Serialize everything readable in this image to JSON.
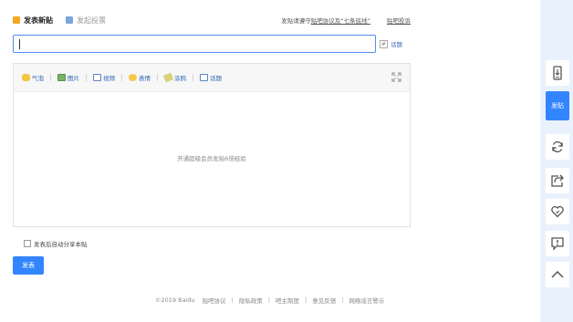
{
  "header": {
    "tab_new_post": "发表新贴",
    "tab_vote": "发起投票",
    "rules_prefix": "发贴请遵守",
    "rules_link": "贴吧协议及“七条底线”",
    "complaint_link": "贴吧投诉"
  },
  "title_input": {
    "value": "",
    "placeholder": ""
  },
  "topic_link": "话题",
  "toolbar": {
    "items": [
      {
        "label": "气泡",
        "icon": "bubble-icon"
      },
      {
        "label": "图片",
        "icon": "picture-icon"
      },
      {
        "label": "视频",
        "icon": "video-icon"
      },
      {
        "label": "表情",
        "icon": "emoji-icon"
      },
      {
        "label": "涂鸦",
        "icon": "doodle-icon"
      },
      {
        "label": "话题",
        "icon": "topic-icon"
      }
    ],
    "expand_icon": "expand-icon"
  },
  "editor": {
    "vip_hint": "开通超级会员发贴6倍经验"
  },
  "share_checkbox": {
    "label": "发表后自动分享本贴",
    "checked": false
  },
  "submit_label": "发表",
  "footer": {
    "items": [
      "©2019 Baidu",
      "贴吧协议",
      "隐私政策",
      "吧主制度",
      "意见反馈",
      "网络谣言警示"
    ],
    "separator": "|"
  },
  "rail": {
    "post_label": "发贴",
    "icons": [
      "mobile-icon",
      "refresh-icon",
      "share-icon",
      "heart-icon",
      "report-icon",
      "back-to-top-icon"
    ]
  },
  "colors": {
    "accent": "#3385ff",
    "link": "#2d64b3",
    "rail_bg": "#e9f2fc"
  }
}
